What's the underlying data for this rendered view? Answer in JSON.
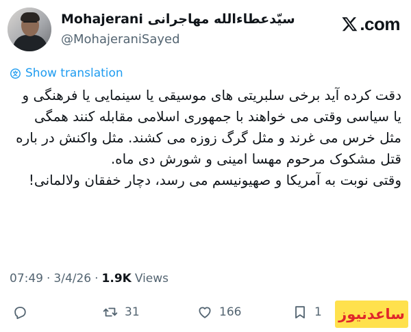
{
  "author": {
    "display_name": "Mohajerani سیّدعطاءالله مهاجرانی",
    "handle": "@MohajeraniSayed",
    "avatar_icon": "profile-photo"
  },
  "brand": {
    "icon": "x-logo-icon",
    "text": ".com"
  },
  "translation": {
    "label": "Show translation",
    "icon": "globe-icon",
    "color": "#1d9bf0"
  },
  "tweet": {
    "paragraphs": [
      "دقت کرده آید برخی سلبریتی های موسیقی یا سینمایی یا فرهنگی و یا سیاسی وقتی می خواهند با جمهوری اسلامی مقابله کنند همگی مثل خرس می غرند و مثل گرگ زوزه می کشند. مثل واکنش در باره قتل مشکوک مرحوم مهسا امینی و شورش دی ماه.",
      "وقتی نوبت به آمریکا و صهیونیسم می رسد، دچار خفقان ولالمانی!"
    ]
  },
  "meta": {
    "time": "07:49",
    "separator": "·",
    "date": "3/4/26",
    "views_count": "1.9K",
    "views_label": "Views"
  },
  "actions": {
    "reply": {
      "icon": "reply-icon",
      "count": ""
    },
    "repost": {
      "icon": "repost-icon",
      "count": "31"
    },
    "like": {
      "icon": "heart-icon",
      "count": "166"
    },
    "bookmark": {
      "icon": "bookmark-icon",
      "count": "1"
    }
  },
  "watermark": {
    "text": "ساعدنیوز",
    "bg_color": "#ffe14d",
    "text_color": "#e0262a"
  }
}
